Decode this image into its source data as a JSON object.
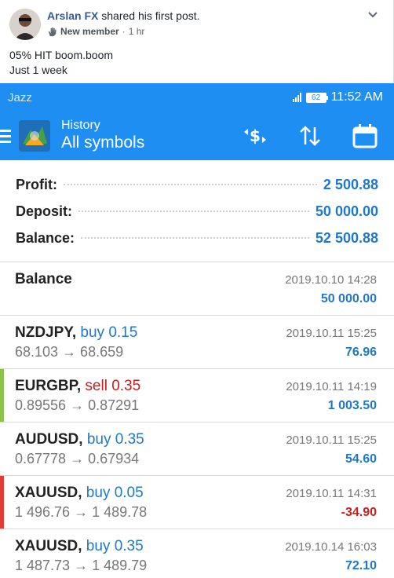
{
  "post": {
    "author": "Arslan FX",
    "action": "shared his first post.",
    "badge": "New member",
    "time": "1 hr",
    "text_line1": "05% HIT boom.boom",
    "text_line2": "Just 1 week"
  },
  "status": {
    "carrier": "Jazz",
    "battery": "62",
    "clock": "11:52 AM"
  },
  "appbar": {
    "title": "History",
    "subtitle": "All symbols"
  },
  "summary": {
    "profit_label": "Profit:",
    "profit_value": "2 500.88",
    "deposit_label": "Deposit:",
    "deposit_value": "50 000.00",
    "balance_label": "Balance:",
    "balance_value": "52 500.88"
  },
  "balance_entry": {
    "label": "Balance",
    "time": "2019.10.10 14:28",
    "amount": "50 000.00"
  },
  "deals": [
    {
      "symbol": "NZDJPY,",
      "type": "buy 0.15",
      "prices": "68.103 → 68.659",
      "time": "2019.10.11 15:25",
      "profit": "76.96"
    },
    {
      "symbol": "EURGBP,",
      "type": "sell 0.35",
      "prices": "0.89556 → 0.87291",
      "time": "2019.10.11 14:19",
      "profit": "1 003.50"
    },
    {
      "symbol": "AUDUSD,",
      "type": "buy 0.35",
      "prices": "0.67778 → 0.67934",
      "time": "2019.10.11 15:25",
      "profit": "54.60"
    },
    {
      "symbol": "XAUUSD,",
      "type": "buy 0.05",
      "prices": "1 496.76 → 1 489.78",
      "time": "2019.10.11 14:31",
      "profit": "-34.90"
    },
    {
      "symbol": "XAUUSD,",
      "type": "buy 0.35",
      "prices": "1 487.73 → 1 489.79",
      "time": "2019.10.14 16:03",
      "profit": "72.10"
    }
  ],
  "colors": {
    "accent": "#1e8ef2",
    "profit_blue": "#1e78c8",
    "loss_red": "#c81e1e",
    "bar_green": "#8bc34a",
    "bar_red": "#e53935"
  }
}
